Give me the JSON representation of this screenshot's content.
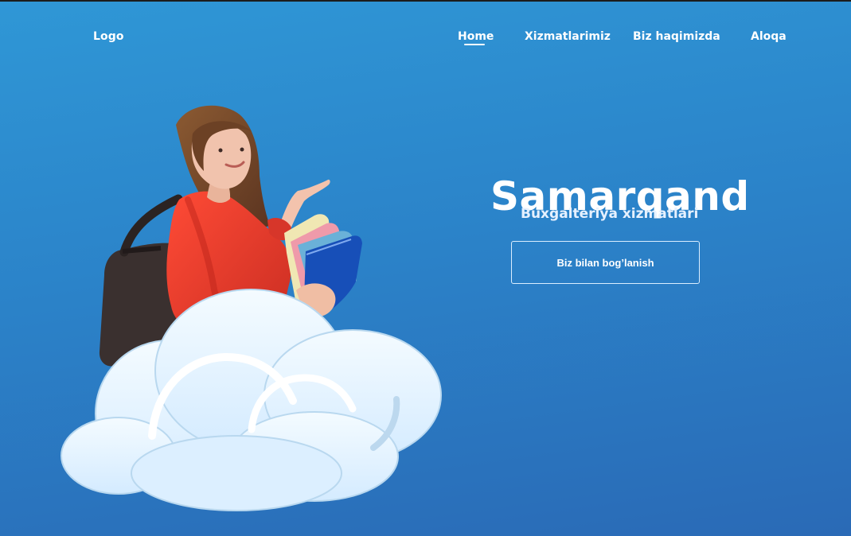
{
  "colors": {
    "background_top": "#2f97d6",
    "background_bottom": "#2a6ab6",
    "text": "#ffffff",
    "cloud_fill": "#e9f5ff",
    "cloud_shadow": "#cfe7fb",
    "shirt_red": "#e23a2b"
  },
  "navbar": {
    "logo": "Logo",
    "links": [
      "Home",
      "Xizmatlarimiz",
      "Biz haqimizda",
      "Aloqa"
    ],
    "active": "Home"
  },
  "hero": {
    "title": "Samarqand",
    "subtitle": "Buxgalteriya xizmatlari",
    "cta_label": "Biz bilan bog’lanish"
  },
  "illustration": {
    "items": [
      "student-girl",
      "backpack",
      "folders",
      "cloud"
    ]
  }
}
